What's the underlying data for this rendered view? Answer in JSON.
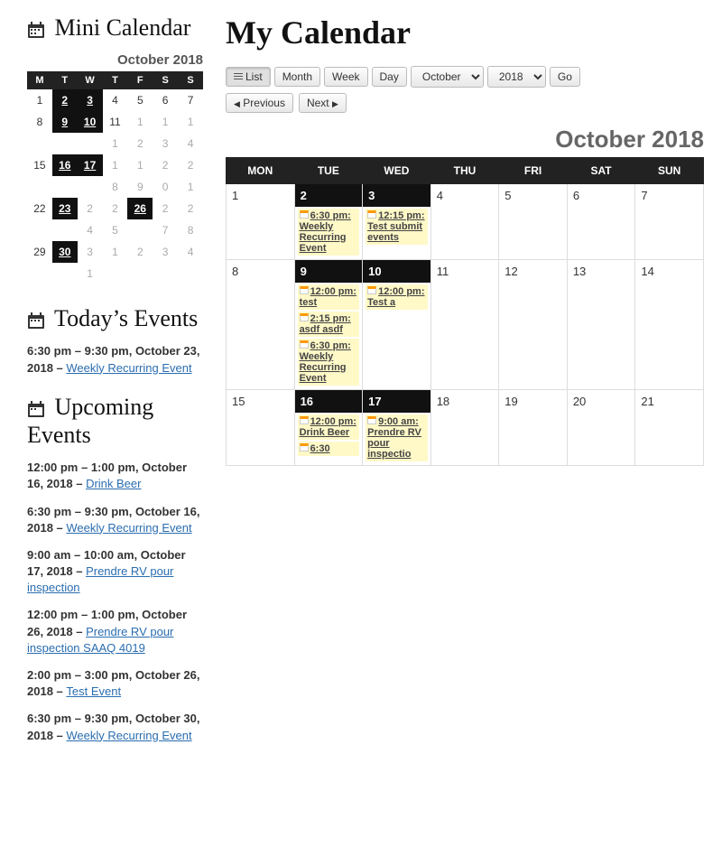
{
  "sidebar": {
    "mini_title": "Mini Calendar",
    "mini_month": "October 2018",
    "days": [
      "M",
      "T",
      "W",
      "T",
      "F",
      "S",
      "S"
    ],
    "grid": [
      [
        {
          "n": "1",
          "e": false
        },
        {
          "n": "2",
          "e": true
        },
        {
          "n": "3",
          "e": true
        },
        {
          "n": "4",
          "e": false
        },
        {
          "n": "5",
          "e": false
        },
        {
          "n": "6",
          "e": false
        },
        {
          "n": "7",
          "e": false
        }
      ],
      [
        {
          "n": "8",
          "e": false
        },
        {
          "n": "9",
          "e": true
        },
        {
          "n": "10",
          "e": true
        },
        {
          "n": "11",
          "e": false
        },
        {
          "n": "1",
          "e": false,
          "o": true
        },
        {
          "n": "1",
          "e": false,
          "o": true
        },
        {
          "n": "1",
          "e": false,
          "o": true
        }
      ],
      [
        {
          "n": "",
          "e": false
        },
        {
          "n": "",
          "e": false
        },
        {
          "n": "",
          "e": false
        },
        {
          "n": "1",
          "e": false,
          "o": true
        },
        {
          "n": "2",
          "e": false,
          "o": true
        },
        {
          "n": "3",
          "e": false,
          "o": true
        },
        {
          "n": "4",
          "e": false,
          "o": true
        }
      ],
      [
        {
          "n": "15",
          "e": false
        },
        {
          "n": "16",
          "e": true
        },
        {
          "n": "17",
          "e": true
        },
        {
          "n": "1",
          "e": false,
          "o": true
        },
        {
          "n": "1",
          "e": false,
          "o": true
        },
        {
          "n": "2",
          "e": false,
          "o": true
        },
        {
          "n": "2",
          "e": false,
          "o": true
        }
      ],
      [
        {
          "n": "",
          "e": false
        },
        {
          "n": "",
          "e": false
        },
        {
          "n": "",
          "e": false
        },
        {
          "n": "8",
          "e": false,
          "o": true
        },
        {
          "n": "9",
          "e": false,
          "o": true
        },
        {
          "n": "0",
          "e": false,
          "o": true
        },
        {
          "n": "1",
          "e": false,
          "o": true
        }
      ],
      [
        {
          "n": "22",
          "e": false
        },
        {
          "n": "23",
          "e": true
        },
        {
          "n": "2",
          "e": false,
          "o": true
        },
        {
          "n": "2",
          "e": false,
          "o": true
        },
        {
          "n": "26",
          "e": true
        },
        {
          "n": "2",
          "e": false,
          "o": true
        },
        {
          "n": "2",
          "e": false,
          "o": true
        }
      ],
      [
        {
          "n": "",
          "e": false
        },
        {
          "n": "",
          "e": false
        },
        {
          "n": "4",
          "e": false,
          "o": true
        },
        {
          "n": "5",
          "e": false,
          "o": true
        },
        {
          "n": "",
          "e": false
        },
        {
          "n": "7",
          "e": false,
          "o": true
        },
        {
          "n": "8",
          "e": false,
          "o": true
        }
      ],
      [
        {
          "n": "29",
          "e": false
        },
        {
          "n": "30",
          "e": true
        },
        {
          "n": "3",
          "e": false,
          "o": true
        },
        {
          "n": "1",
          "e": false,
          "o": true
        },
        {
          "n": "2",
          "e": false,
          "o": true
        },
        {
          "n": "3",
          "e": false,
          "o": true
        },
        {
          "n": "4",
          "e": false,
          "o": true
        }
      ],
      [
        {
          "n": "",
          "e": false
        },
        {
          "n": "",
          "e": false
        },
        {
          "n": "1",
          "e": false,
          "o": true
        },
        {
          "n": "",
          "e": false
        },
        {
          "n": "",
          "e": false
        },
        {
          "n": "",
          "e": false
        },
        {
          "n": "",
          "e": false
        }
      ]
    ],
    "today_title": "Today’s Events",
    "today_events": [
      {
        "time": "6:30 pm – 9:30 pm, October 23, 2018",
        "link": "Weekly Recurring Event"
      }
    ],
    "upcoming_title": "Upcoming Events",
    "upcoming_events": [
      {
        "time": "12:00 pm – 1:00 pm, October 16, 2018",
        "link": "Drink Beer"
      },
      {
        "time": "6:30 pm – 9:30 pm, October 16, 2018",
        "link": "Weekly Recurring Event"
      },
      {
        "time": "9:00 am – 10:00 am, October 17, 2018",
        "link": "Prendre RV pour inspection"
      },
      {
        "time": "12:00 pm – 1:00 pm, October 26, 2018",
        "link": "Prendre RV pour inspection SAAQ 4019"
      },
      {
        "time": "2:00 pm – 3:00 pm, October 26, 2018",
        "link": "Test Event"
      },
      {
        "time": "6:30 pm – 9:30 pm, October 30, 2018",
        "link": "Weekly Recurring Event"
      }
    ]
  },
  "main": {
    "title": "My Calendar",
    "view_list": "List",
    "view_month": "Month",
    "view_week": "Week",
    "view_day": "Day",
    "month_select": "October",
    "year_select": "2018",
    "go": "Go",
    "prev": "Previous",
    "next": "Next",
    "month_title": "October 2018",
    "headers": [
      "MON",
      "TUE",
      "WED",
      "THU",
      "FRI",
      "SAT",
      "SUN"
    ],
    "weeks": [
      [
        {
          "n": "1"
        },
        {
          "n": "2",
          "has": true,
          "events": [
            {
              "t": "6:30 pm: Weekly Recurring Event"
            }
          ]
        },
        {
          "n": "3",
          "has": true,
          "events": [
            {
              "t": "12:15 pm: Test submit events"
            }
          ]
        },
        {
          "n": "4"
        },
        {
          "n": "5"
        },
        {
          "n": "6"
        },
        {
          "n": "7"
        }
      ],
      [
        {
          "n": "8"
        },
        {
          "n": "9",
          "has": true,
          "events": [
            {
              "t": "12:00 pm: test"
            },
            {
              "t": "2:15 pm: asdf asdf"
            },
            {
              "t": "6:30 pm: Weekly Recurring Event"
            }
          ]
        },
        {
          "n": "10",
          "has": true,
          "events": [
            {
              "t": "12:00 pm: Test a"
            }
          ]
        },
        {
          "n": "11"
        },
        {
          "n": "12"
        },
        {
          "n": "13"
        },
        {
          "n": "14"
        }
      ],
      [
        {
          "n": "15"
        },
        {
          "n": "16",
          "has": true,
          "events": [
            {
              "t": "12:00 pm: Drink Beer"
            },
            {
              "t": "6:30"
            }
          ]
        },
        {
          "n": "17",
          "has": true,
          "events": [
            {
              "t": "9:00 am: Prendre RV pour inspectio"
            }
          ]
        },
        {
          "n": "18"
        },
        {
          "n": "19"
        },
        {
          "n": "20"
        },
        {
          "n": "21"
        }
      ]
    ]
  }
}
